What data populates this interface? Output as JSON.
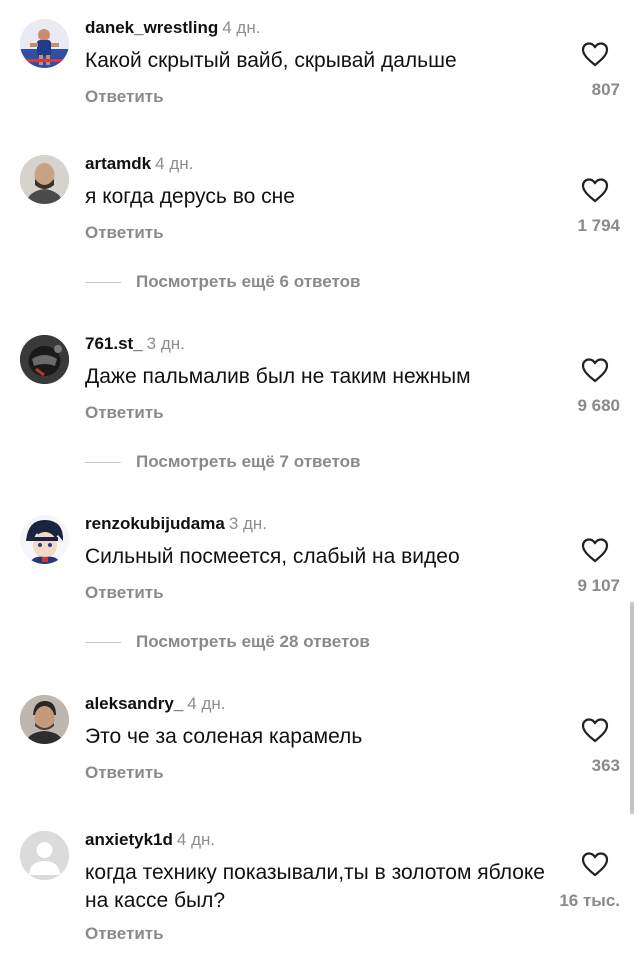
{
  "comments": [
    {
      "username": "danek_wrestling",
      "time": "4 дн.",
      "text": "Какой скрытый вайб, скрывай дальше",
      "reply_label": "Ответить",
      "likes": "807",
      "avatar_icon": "wrestler-photo"
    },
    {
      "username": "artamdk",
      "time": "4 дн.",
      "text": "я когда дерусь во сне",
      "reply_label": "Ответить",
      "likes": "1 794",
      "avatar_icon": "bald-man-photo",
      "view_more": "Посмотреть ещё 6 ответов"
    },
    {
      "username": "761.st_",
      "time": "3 дн.",
      "text": "Даже пальмалив был не таким нежным",
      "reply_label": "Ответить",
      "likes": "9 680",
      "avatar_icon": "helmet-photo",
      "view_more": "Посмотреть ещё 7 ответов"
    },
    {
      "username": "renzokubijudama",
      "time": "3 дн.",
      "text": "Сильный посмеется, слабый на видео",
      "reply_label": "Ответить",
      "likes": "9 107",
      "avatar_icon": "anime-character",
      "view_more": "Посмотреть ещё 28 ответов"
    },
    {
      "username": "aleksandry_",
      "time": "4 дн.",
      "text": "Это че за соленая карамель",
      "reply_label": "Ответить",
      "likes": "363",
      "avatar_icon": "man-portrait-photo"
    },
    {
      "username": "anxietyk1d",
      "time": "4 дн.",
      "text": "когда технику показывали,ты в золотом яблоке на кассе был?",
      "reply_label": "Ответить",
      "likes": "16 тыс.",
      "avatar_icon": "default-user-icon"
    }
  ],
  "colors": {
    "text": "#111111",
    "secondary": "#8e8e8e",
    "action": "#8a8a8a",
    "divider": "#c8c8c8"
  }
}
